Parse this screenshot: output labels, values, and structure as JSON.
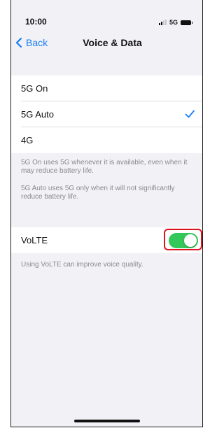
{
  "status_bar": {
    "time": "10:00",
    "network": "5G",
    "signal_icon": "signal-bars-icon",
    "battery_icon": "battery-icon"
  },
  "nav": {
    "back_label": "Back",
    "back_icon": "chevron-left-icon",
    "title": "Voice & Data"
  },
  "options": {
    "items": [
      {
        "label": "5G On",
        "selected": false
      },
      {
        "label": "5G Auto",
        "selected": true
      },
      {
        "label": "4G",
        "selected": false
      }
    ],
    "check_icon": "checkmark-icon"
  },
  "footnotes": {
    "note1": "5G On uses 5G whenever it is available, even when it may reduce battery life.",
    "note2": "5G Auto uses 5G only when it will not significantly reduce battery life."
  },
  "volte": {
    "label": "VoLTE",
    "enabled": true,
    "footnote": "Using VoLTE can improve voice quality."
  },
  "colors": {
    "accent": "#1a7cf5",
    "toggle_on": "#34c759",
    "highlight": "#e0141e",
    "background": "#f2f2f6"
  }
}
